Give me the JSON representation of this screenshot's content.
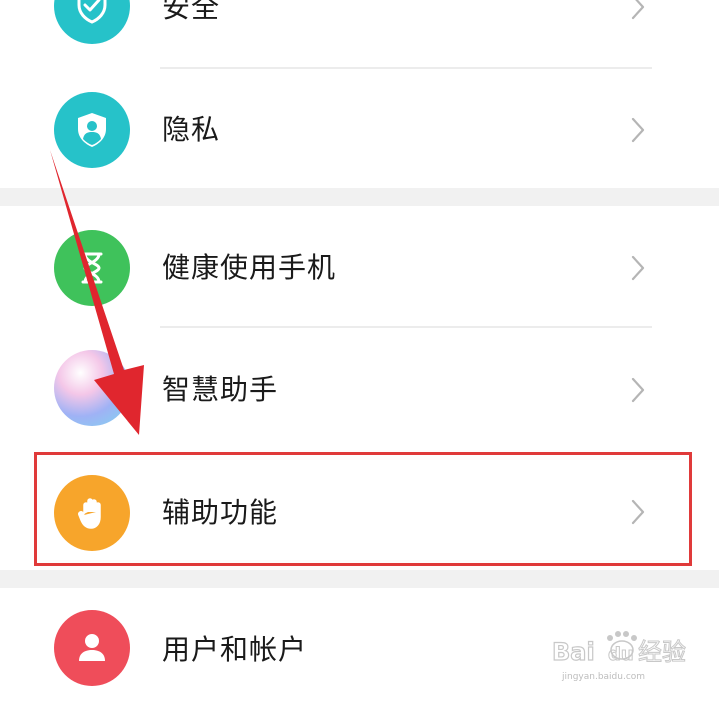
{
  "settings": {
    "items": [
      {
        "label": "安全",
        "icon": "security-check-icon",
        "color": "#26c2c9"
      },
      {
        "label": "隐私",
        "icon": "privacy-shield-icon",
        "color": "#26c2c9"
      },
      {
        "label": "健康使用手机",
        "icon": "hourglass-icon",
        "color": "#3fc25b"
      },
      {
        "label": "智慧助手",
        "icon": "smart-assistant-orb-icon",
        "color": "#9b8cf0"
      },
      {
        "label": "辅助功能",
        "icon": "hand-icon",
        "color": "#f7a52b"
      },
      {
        "label": "用户和帐户",
        "icon": "user-icon",
        "color": "#ef4d5a"
      }
    ],
    "highlighted_item": "辅助功能",
    "highlight_color": "#e03a3a",
    "arrow_color": "#e0262e"
  },
  "watermark": {
    "brand": "Bai du 经验",
    "url": "jingyan.baidu.com"
  }
}
